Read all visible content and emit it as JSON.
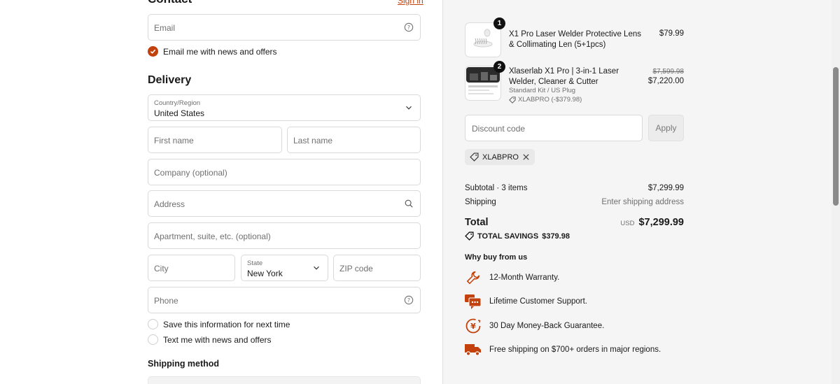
{
  "contact": {
    "heading": "Contact",
    "sign_in": "Sign in",
    "email_placeholder": "Email",
    "email_news_label": "Email me with news and offers"
  },
  "delivery": {
    "heading": "Delivery",
    "country_label": "Country/Region",
    "country_value": "United States",
    "first_name_placeholder": "First name",
    "last_name_placeholder": "Last name",
    "company_placeholder": "Company (optional)",
    "address_placeholder": "Address",
    "apartment_placeholder": "Apartment, suite, etc. (optional)",
    "city_placeholder": "City",
    "state_label": "State",
    "state_value": "New York",
    "zip_placeholder": "ZIP code",
    "phone_placeholder": "Phone",
    "save_info_label": "Save this information for next time",
    "text_news_label": "Text me with news and offers"
  },
  "shipping_method": {
    "heading": "Shipping method"
  },
  "cart": {
    "items": [
      {
        "quantity": "1",
        "name": "X1 Pro Laser Welder Protective Lens & Collimating Len (5+1pcs)",
        "price": "$79.99"
      },
      {
        "quantity": "2",
        "name": "Xlaserlab X1 Pro | 3-in-1 Laser Welder, Cleaner & Cutter",
        "variant": "Standard Kit / US Plug",
        "discount": "XLABPRO (-$379.98)",
        "original_price": "$7,599.98",
        "price": "$7,220.00"
      }
    ],
    "discount_placeholder": "Discount code",
    "apply_label": "Apply",
    "applied_code": "XLABPRO",
    "subtotal_label": "Subtotal · 3 items",
    "subtotal_value": "$7,299.99",
    "shipping_label": "Shipping",
    "shipping_value": "Enter shipping address",
    "total_label": "Total",
    "currency": "USD",
    "total_value": "$7,299.99",
    "savings_label": "TOTAL SAVINGS",
    "savings_value": "$379.98"
  },
  "why_buy": {
    "heading": "Why buy from us",
    "items": [
      {
        "icon": "wrench-icon",
        "label": "12-Month Warranty."
      },
      {
        "icon": "chat-support-icon",
        "label": "Lifetime Customer Support."
      },
      {
        "icon": "money-back-icon",
        "label": "30 Day Money-Back Guarantee."
      },
      {
        "icon": "truck-icon",
        "label": "Free shipping on $700+ orders in major regions."
      }
    ]
  },
  "colors": {
    "accent": "#c2410c",
    "summary_bg": "#f5f5f5"
  }
}
